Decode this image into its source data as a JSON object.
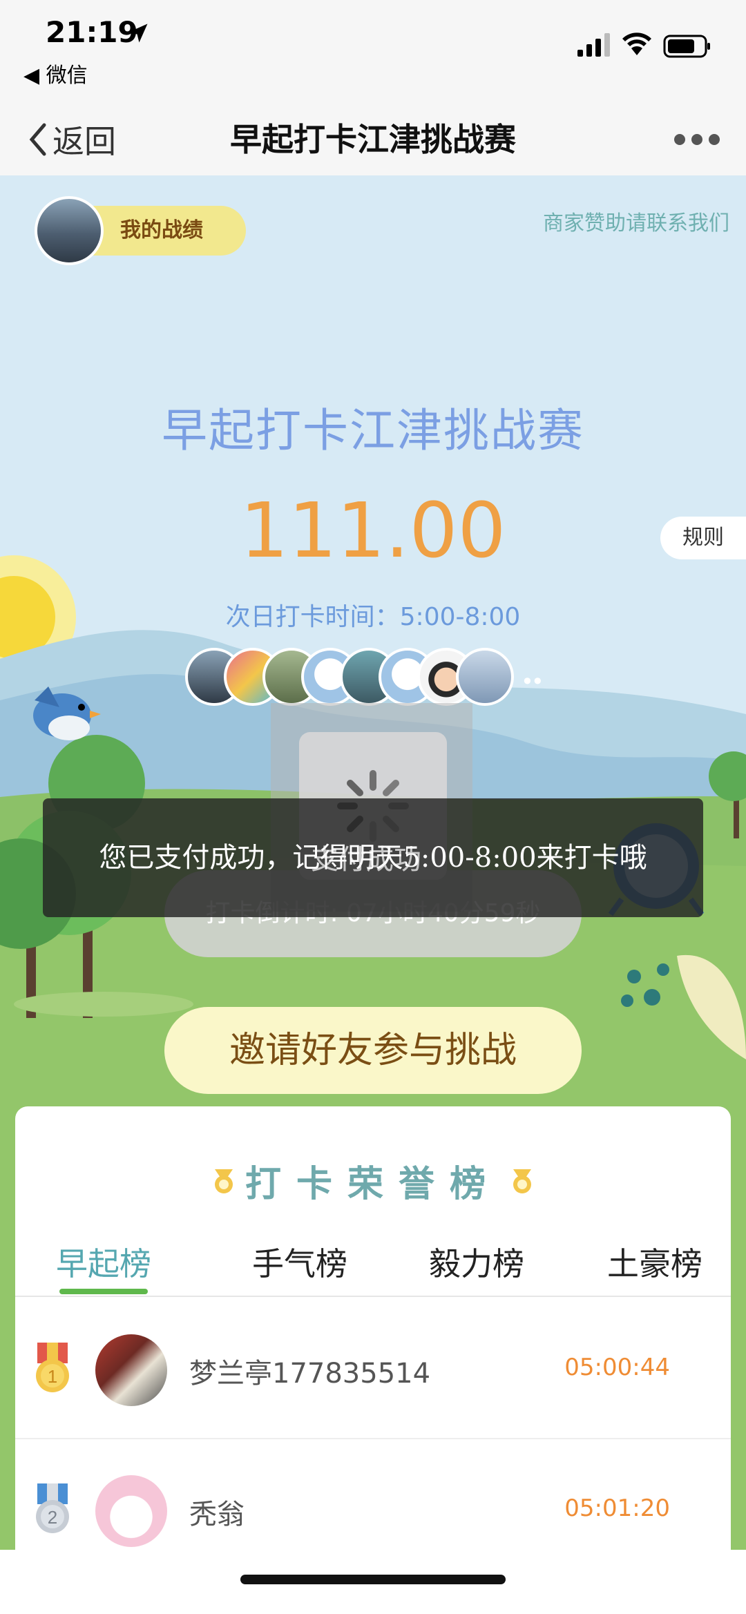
{
  "status_bar": {
    "time": "21:19",
    "back_app": "◀ 微信"
  },
  "nav": {
    "back_label": "返回",
    "title": "早起打卡江津挑战赛"
  },
  "header": {
    "my_record": "我的战绩",
    "sponsor": "商家赞助请联系我们"
  },
  "challenge": {
    "title": "早起打卡江津挑战赛",
    "amount": "111.00",
    "rules": "规则",
    "next_time": "次日打卡时间：5:00-8:00",
    "countdown": "打卡倒计时: 07小时40分59秒",
    "participants_more": "••"
  },
  "invite_button": "邀请好友参与挑战",
  "board": {
    "title": "打卡荣誉榜",
    "tabs": [
      "早起榜",
      "手气榜",
      "毅力榜",
      "土豪榜"
    ],
    "active_tab": 0,
    "rows": [
      {
        "rank": "1",
        "name": "梦兰亭177835514",
        "time": "05:00:44"
      },
      {
        "rank": "2",
        "name": "秃翁",
        "time": "05:01:20"
      }
    ]
  },
  "overlay": {
    "toast": "您已支付成功，记得明天5:00-8:00来打卡哦",
    "loading_text": "支付成功"
  },
  "colors": {
    "accent_teal": "#6fa9ac",
    "amount_orange": "#efa044",
    "tab_underline": "#5fb84c",
    "time_orange": "#ef8c34"
  }
}
